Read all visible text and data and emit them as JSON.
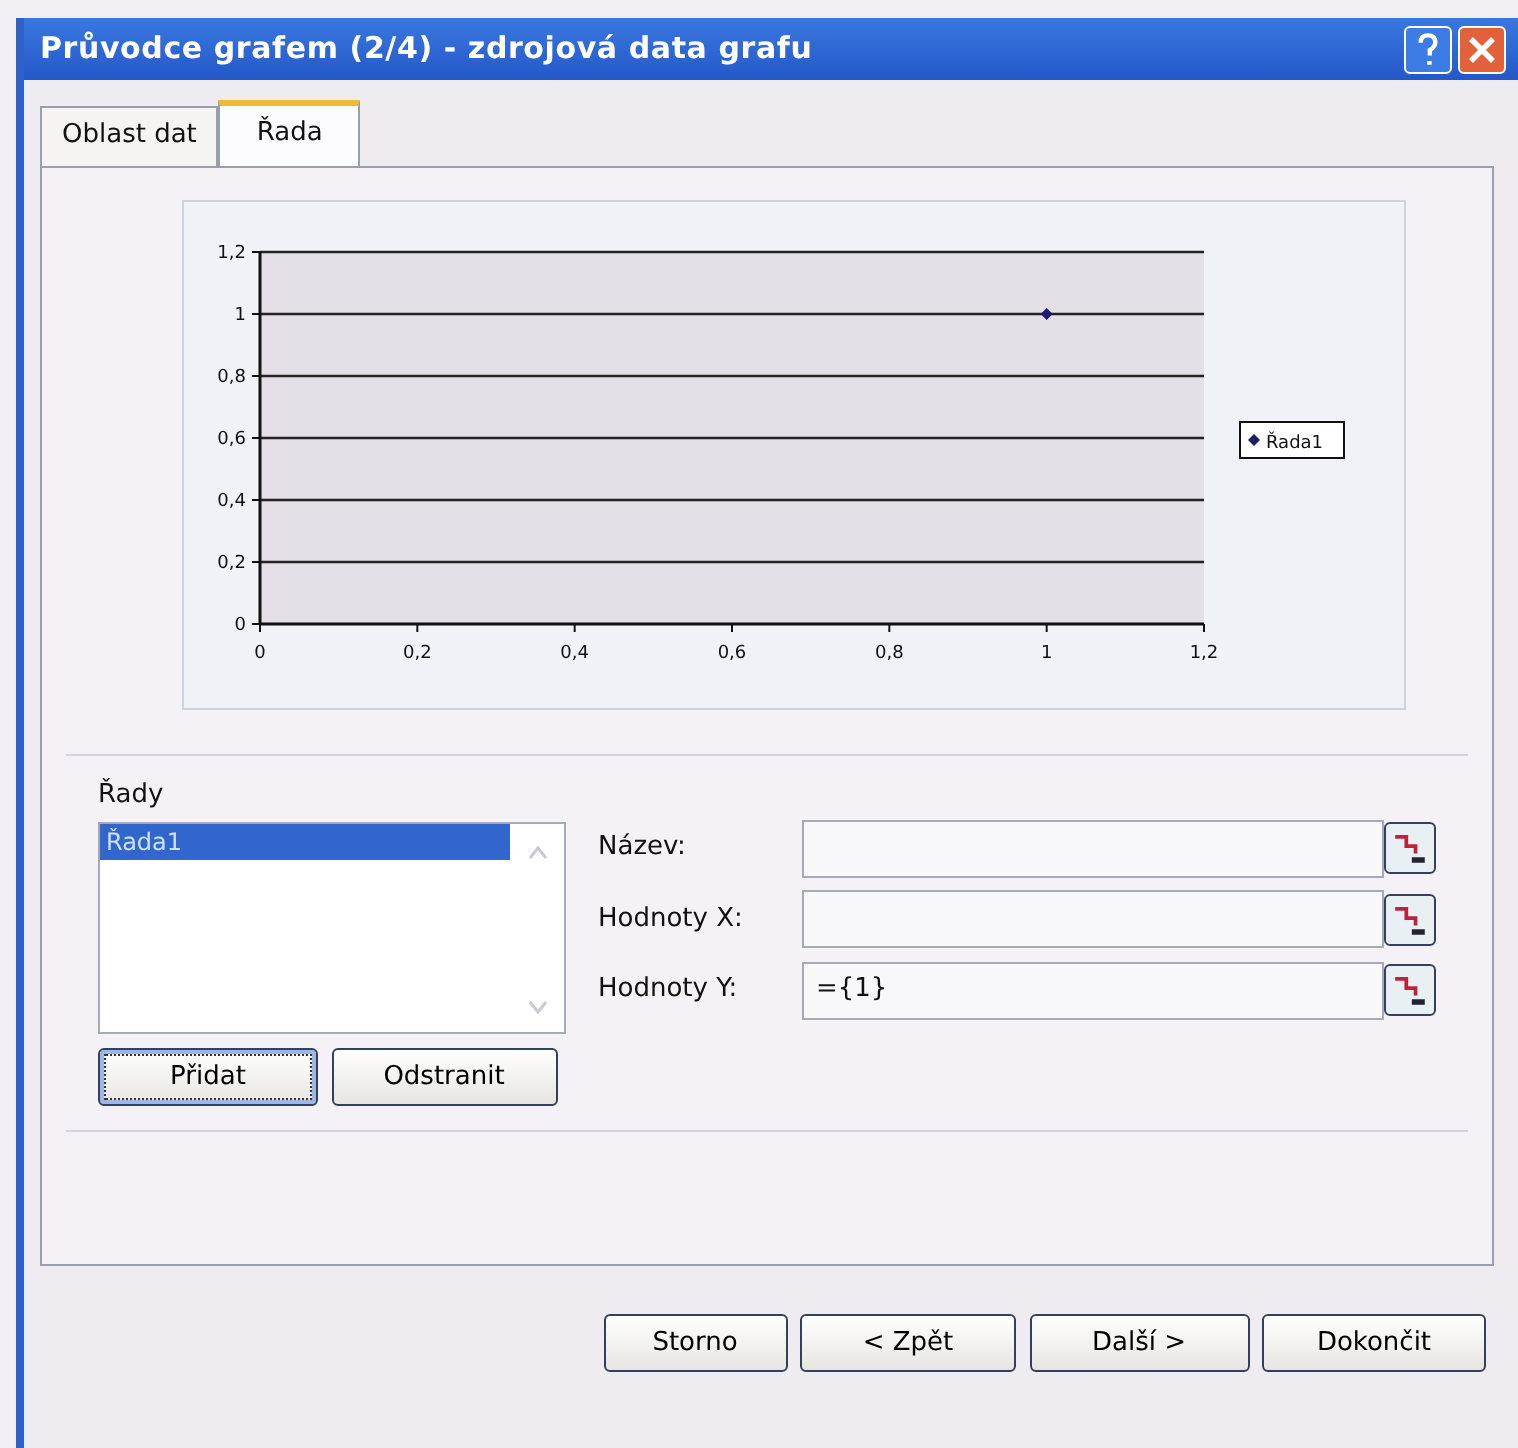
{
  "window": {
    "title": "Průvodce grafem (2/4) - zdrojová data grafu"
  },
  "tabs": [
    {
      "label": "Oblast dat",
      "selected": false
    },
    {
      "label": "Řada",
      "selected": true
    }
  ],
  "chart": {
    "chart_data": {
      "type": "scatter",
      "grid": true,
      "x": [
        1
      ],
      "series": [
        {
          "name": "Řada1",
          "color": "#1c1c6e",
          "values": [
            1
          ]
        }
      ],
      "xlim": [
        0,
        1.2
      ],
      "ylim": [
        0,
        1.2
      ],
      "xticks": [
        {
          "value": 0,
          "label": "0"
        },
        {
          "value": 0.2,
          "label": "0,2"
        },
        {
          "value": 0.4,
          "label": "0,4"
        },
        {
          "value": 0.6,
          "label": "0,6"
        },
        {
          "value": 0.8,
          "label": "0,8"
        },
        {
          "value": 1,
          "label": "1"
        },
        {
          "value": 1.2,
          "label": "1,2"
        }
      ],
      "yticks": [
        {
          "value": 0,
          "label": "0"
        },
        {
          "value": 0.2,
          "label": "0,2"
        },
        {
          "value": 0.4,
          "label": "0,4"
        },
        {
          "value": 0.6,
          "label": "0,6"
        },
        {
          "value": 0.8,
          "label": "0,8"
        },
        {
          "value": 1,
          "label": "1"
        },
        {
          "value": 1.2,
          "label": "1,2"
        }
      ]
    }
  },
  "series_list": {
    "label": "Řady",
    "items": [
      {
        "label": "Řada1",
        "selected": true
      }
    ]
  },
  "list_buttons": [
    {
      "label": "Přidat",
      "focused": true
    },
    {
      "label": "Odstranit",
      "focused": false
    }
  ],
  "fields": [
    {
      "label": "Název:"
    },
    {
      "label": "Hodnoty X:"
    },
    {
      "label": "Hodnoty Y:",
      "value": "={1}"
    }
  ],
  "footer_buttons": [
    {
      "label": "Storno"
    },
    {
      "label": "< Zpět"
    },
    {
      "label": "Další >"
    },
    {
      "label": "Dokončit"
    }
  ]
}
